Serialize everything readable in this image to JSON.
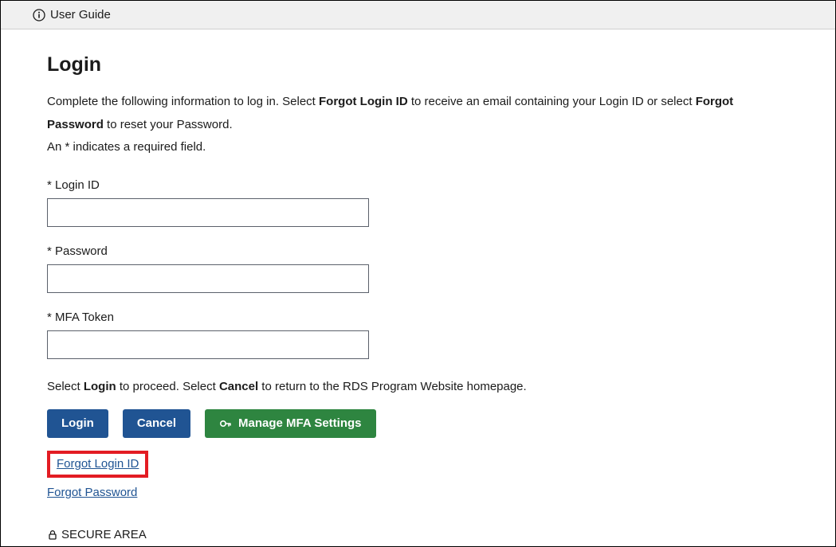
{
  "topbar": {
    "label": "User Guide"
  },
  "page_title": "Login",
  "instructions": {
    "part1": "Complete the following information to log in. Select ",
    "strong1": "Forgot Login ID",
    "part2": " to receive an email containing your Login ID or select ",
    "strong2": "Forgot Password",
    "part3": " to reset your Password.",
    "required_note": "An * indicates a required field."
  },
  "fields": {
    "login_id": {
      "label": "* Login ID",
      "value": ""
    },
    "password": {
      "label": "* Password",
      "value": ""
    },
    "mfa_token": {
      "label": "* MFA Token",
      "value": ""
    }
  },
  "help_line": {
    "part1": "Select ",
    "strong1": "Login",
    "part2": " to proceed. Select ",
    "strong2": "Cancel",
    "part3": " to return to the RDS Program Website homepage."
  },
  "buttons": {
    "login": "Login",
    "cancel": "Cancel",
    "manage_mfa": "Manage MFA Settings"
  },
  "links": {
    "forgot_login": "Forgot Login ID",
    "forgot_password": "Forgot Password"
  },
  "secure_area": "SECURE AREA"
}
